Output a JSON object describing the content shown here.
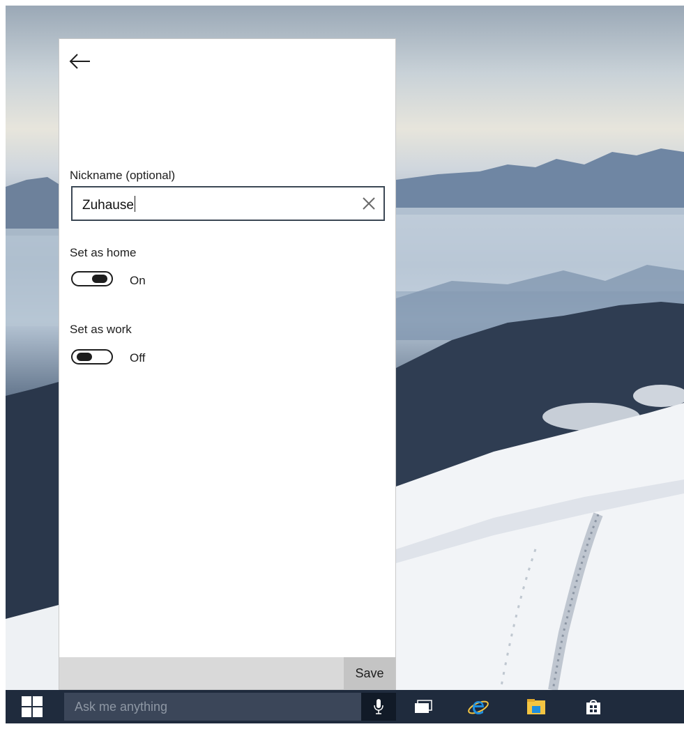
{
  "panel": {
    "nickname_label": "Nickname (optional)",
    "nickname_value": "Zuhause",
    "home_label": "Set as home",
    "home_state": "On",
    "work_label": "Set as work",
    "work_state": "Off",
    "save_label": "Save"
  },
  "taskbar": {
    "search_placeholder": "Ask me anything"
  },
  "icons": [
    "back-arrow-icon",
    "clear-icon",
    "windows-logo-icon",
    "microphone-icon",
    "task-view-icon",
    "internet-explorer-icon",
    "file-explorer-icon",
    "store-icon"
  ],
  "colors": {
    "taskbar": "#1f2b3d",
    "search_box": "#3b4659",
    "input_border": "#3b4754",
    "accent_ie": "#1e8fe0",
    "folder_yellow": "#f4c542"
  }
}
